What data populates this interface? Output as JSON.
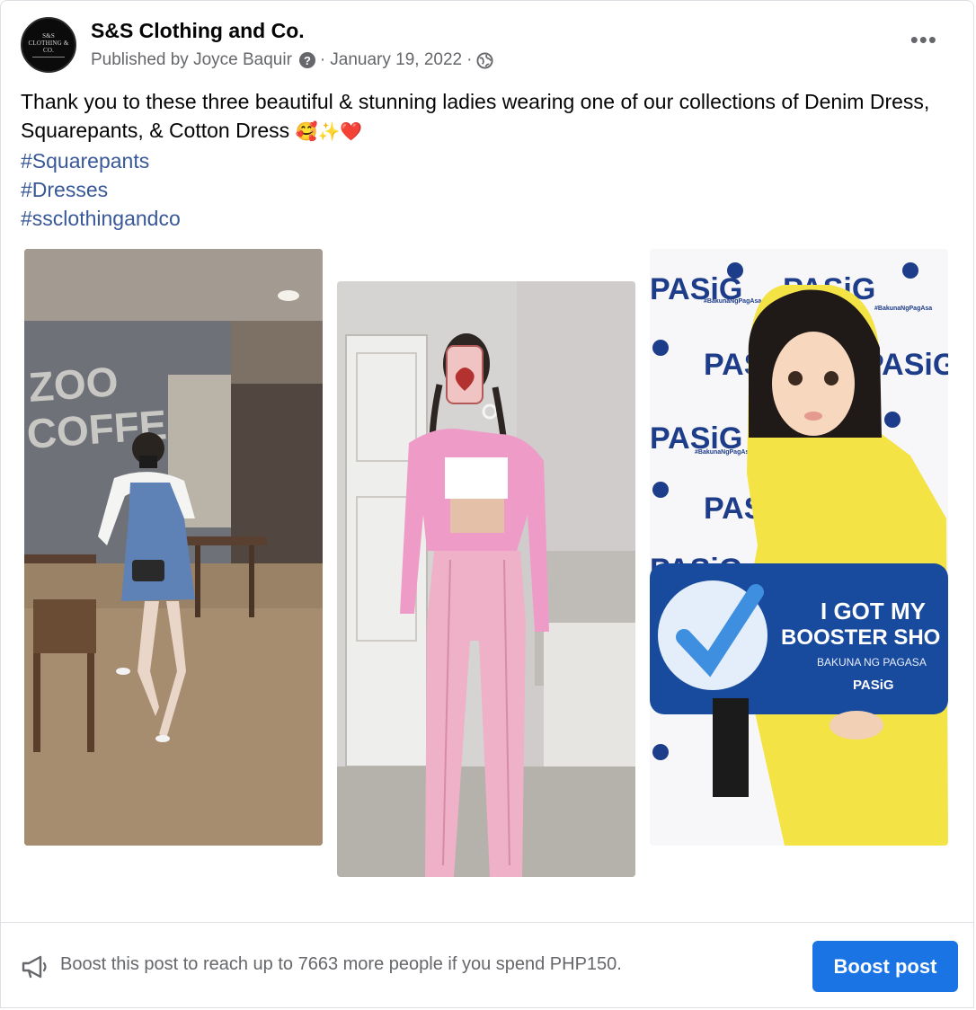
{
  "post": {
    "page_name": "S&S Clothing and Co.",
    "avatar_text": "S&S CLOTHING & CO.",
    "published_by": "Published by Joyce Baquir",
    "date": "January 19, 2022",
    "separator": "·",
    "help_icon": "question-icon",
    "audience_icon": "globe-icon",
    "more_icon": "more-options-icon",
    "more_symbol": "•••",
    "text_line": "Thank you to these three beautiful & stunning ladies wearing one of our collections of Denim Dress, Squarepants, & Cotton Dress",
    "emojis": "🥰✨❤️",
    "hashtags": [
      "#Squarepants",
      "#Dresses",
      "#ssclothingandco"
    ]
  },
  "photos": [
    {
      "name": "photo-denim-dress",
      "wall_text_1": "ZOO",
      "wall_text_2": "COFFEE"
    },
    {
      "name": "photo-squarepants"
    },
    {
      "name": "photo-cotton-dress",
      "brand": "PASiG",
      "hashtag": "#BakunaNgPagAsa",
      "sign_line_1": "I GOT MY",
      "sign_line_2": "BOOSTER SHO",
      "sign_line_3": "BAKUNA NG PAGASA",
      "sign_line_4": "PASiG"
    }
  ],
  "footer": {
    "boost_icon": "megaphone-icon",
    "boost_text": "Boost this post to reach up to 7663 more people if you spend PHP150.",
    "boost_button": "Boost post"
  },
  "colors": {
    "accent": "#1b74e4",
    "hashtag": "#385898",
    "meta_text": "#65676b"
  }
}
